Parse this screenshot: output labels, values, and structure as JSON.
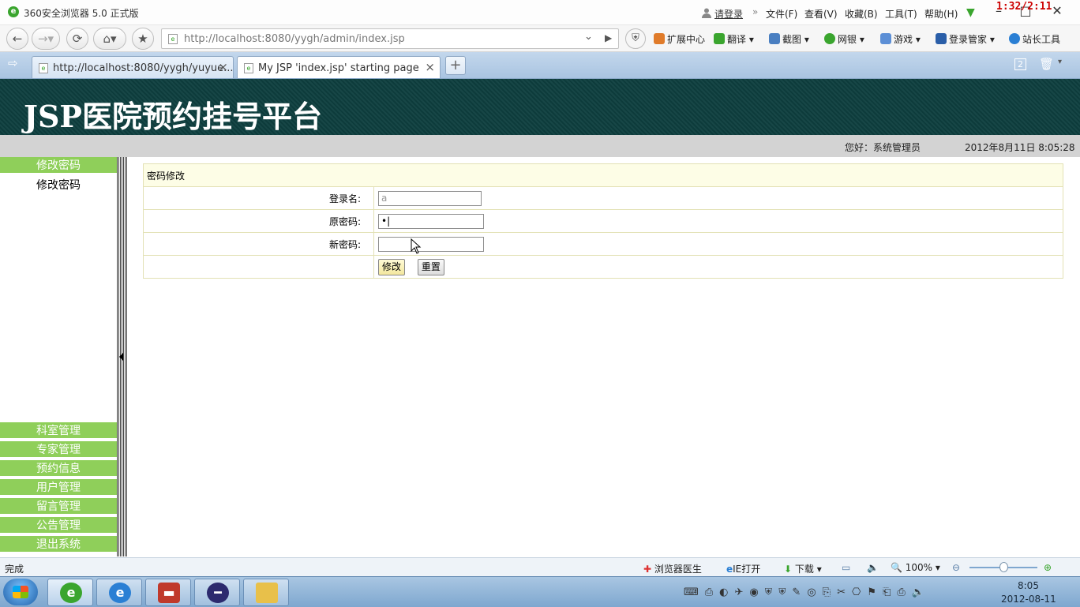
{
  "browser": {
    "title": "360安全浏览器 5.0 正式版",
    "login_link": "请登录",
    "menus": [
      "文件(F)",
      "查看(V)",
      "收藏(B)",
      "工具(T)",
      "帮助(H)"
    ],
    "overlay_time": "1:32/2:11",
    "address_url": "http://localhost:8080/yygh/admin/index.jsp",
    "toolbar_items": [
      {
        "label": "扩展中心",
        "color": "#e07b2a"
      },
      {
        "label": "翻译",
        "color": "#3aa52e"
      },
      {
        "label": "截图",
        "color": "#4a7fc1"
      },
      {
        "label": "网银",
        "color": "#3aa52e"
      },
      {
        "label": "游戏",
        "color": "#5c8fd6"
      },
      {
        "label": "登录管家",
        "color": "#2a5ea8"
      },
      {
        "label": "站长工具",
        "color": "#2a7fd4"
      }
    ],
    "tabs": [
      {
        "label": "http://localhost:8080/yygh/yuyue...",
        "active": false
      },
      {
        "label": "My JSP 'index.jsp' starting page",
        "active": true
      }
    ],
    "tab_count": "2"
  },
  "page": {
    "brand": "JSP医院预约挂号平台",
    "greeting": "您好：系统管理员",
    "datetime": "2012年8月11日  8:05:28",
    "menu": {
      "top_head": "修改密码",
      "top_sub": "修改密码",
      "items": [
        "科室管理",
        "专家管理",
        "预约信息",
        "用户管理",
        "留言管理",
        "公告管理",
        "退出系统"
      ]
    },
    "form": {
      "title": "密码修改",
      "login_label": "登录名:",
      "login_value": "a",
      "old_pwd_label": "原密码:",
      "old_pwd_value": "•|",
      "new_pwd_label": "新密码:",
      "new_pwd_value": "",
      "submit_label": "修改",
      "reset_label": "重置"
    }
  },
  "status": {
    "state": "完成",
    "doctor": "浏览器医生",
    "ie_open": "IE打开",
    "download": "下载",
    "zoom": "100%"
  },
  "taskbar": {
    "time": "8:05",
    "date": "2012-08-11"
  }
}
